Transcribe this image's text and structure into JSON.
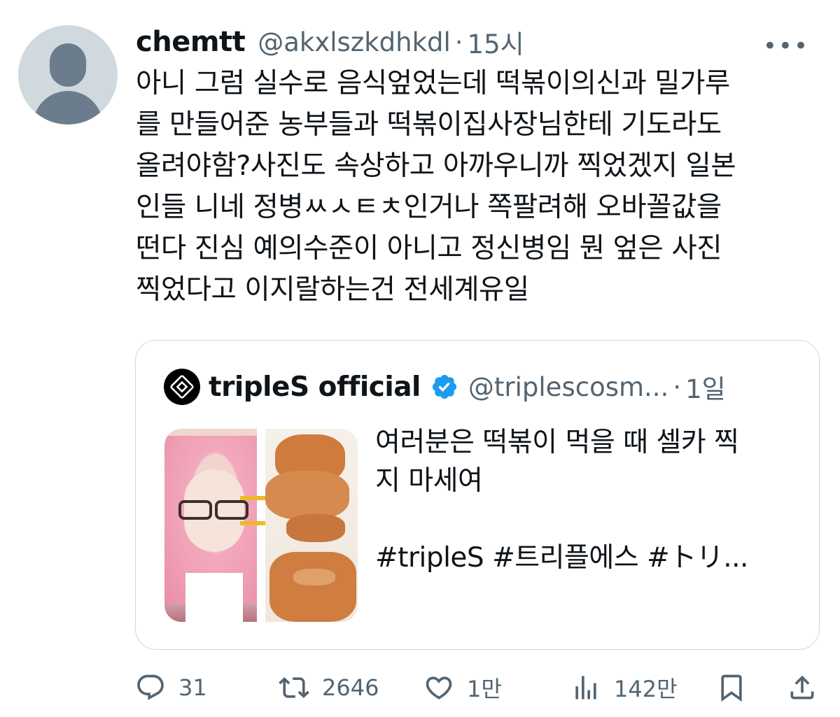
{
  "author": {
    "name": "chemtt",
    "handle": "@akxlszkdhkdl",
    "separator": "·",
    "time": "15시",
    "more_label": "•••"
  },
  "body_text": "아니 그럼 실수로 음식엎었는데 떡볶이의신과 밀가루\n를 만들어준 농부들과 떡볶이집사장님한테 기도라도\n올려야함?사진도 속상하고 아까우니까 찍었겠지 일본\n인들 니네 정병ㅆㅅㅌㅊ인거나 쪽팔려해 오바꼴값을\n떤다 진심 예의수준이 아니고 정신병임 뭔 엎은 사진\n찍었다고 이지랄하는건 전세계유일",
  "quote": {
    "name": "tripleS official",
    "handle": "@triplescosm...",
    "separator": "·",
    "time": "1일",
    "text": "여러분은 떡볶이 먹을 때 셀카 찍\n지 마세여\n\n#tripleS #트리플에스 #トリ..."
  },
  "actions": {
    "replies": "31",
    "retweets": "2646",
    "likes": "1만",
    "views": "142만"
  },
  "colors": {
    "text": "#0f1419",
    "secondary": "#536471",
    "border": "#cfd9de",
    "verified": "#1d9bf0"
  }
}
